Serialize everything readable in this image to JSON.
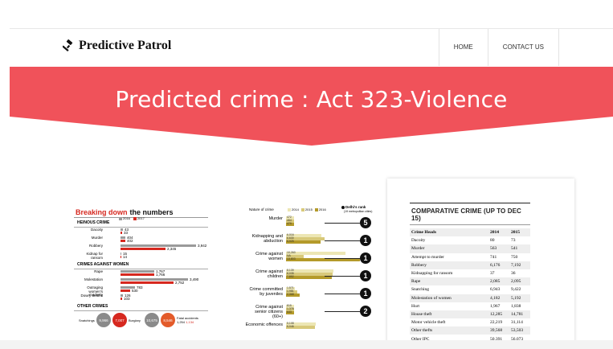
{
  "brand": {
    "name": "Predictive Patrol",
    "icon": "gavel-icon"
  },
  "nav": {
    "items": [
      {
        "label": "HOME"
      },
      {
        "label": "CONTACT US"
      }
    ]
  },
  "banner": {
    "title": "Predicted crime : Act 323-Violence",
    "color": "#f0525a"
  },
  "card1": {
    "title_red": "Breaking down",
    "title_black": "the numbers",
    "legend": [
      "2016",
      "2017"
    ],
    "legend_colors": [
      "#9a9a9a",
      "#d6281f"
    ],
    "sections": [
      {
        "name": "HEINOUS CRIME",
        "rows": [
          {
            "label": "Dacoity",
            "v1": "43",
            "v2": "33",
            "w1": 3,
            "w2": 2
          },
          {
            "label": "Murder",
            "v1": "404",
            "v2": "402",
            "w1": 6,
            "w2": 6
          },
          {
            "label": "Robbery",
            "v1": "3,942",
            "v2": "2,345",
            "w1": 94,
            "w2": 56
          },
          {
            "label": "Kidnap for ransom",
            "v1": "15",
            "v2": "14",
            "w1": 1,
            "w2": 1
          }
        ]
      },
      {
        "name": "CRIMES AGAINST WOMEN",
        "rows": [
          {
            "label": "Rape",
            "v1": "1,767",
            "v2": "1,766",
            "w1": 42,
            "w2": 42
          },
          {
            "label": "Molestation",
            "v1": "3,490",
            "v2": "2,752",
            "w1": 84,
            "w2": 66
          },
          {
            "label": "Outraging women's modesty",
            "v1": "783",
            "v2": "530",
            "w1": 18,
            "w2": 12
          },
          {
            "label": "Dowry deaths",
            "v1": "126",
            "v2": "103",
            "w1": 3,
            "w2": 2
          }
        ]
      }
    ],
    "other": {
      "name": "OTHER CRIMES",
      "circles": [
        {
          "label": "Snatchings",
          "v": "9,966",
          "color": "#8a8a8a"
        },
        {
          "label": "",
          "v": "7,007",
          "color": "#d6281f"
        },
        {
          "label": "Burglary",
          "v": "10,675",
          "color": "#8a8a8a"
        },
        {
          "label": "",
          "v": "8,546",
          "color": "#e35b2a"
        }
      ],
      "fatal": {
        "label": "Fatal accidents",
        "v1": "1,254",
        "v2": "1,134"
      }
    }
  },
  "card2": {
    "col_title": "Nature of crime",
    "legend": [
      "2014",
      "2015",
      "2016"
    ],
    "legend_colors": [
      "#ece6b4",
      "#d8c97a",
      "#b49a2a"
    ],
    "rank_title": "Delhi's rank",
    "rank_sub": "(19 metropolitan cities)",
    "rows": [
      {
        "label": "Murder",
        "bars": [
          "472",
          "464",
          "479"
        ],
        "widths": [
          6,
          6,
          6
        ],
        "rank": "5"
      },
      {
        "label": "Kidnapping and abduction",
        "bars": [
          "6,016",
          "6,630",
          "5,925"
        ],
        "widths": [
          44,
          48,
          43
        ],
        "rank": "1"
      },
      {
        "label": "Crime against women",
        "bars": [
          "10,260",
          "NA",
          "13,803"
        ],
        "widths": [
          74,
          22,
          92
        ],
        "rank": "1"
      },
      {
        "label": "Crime against children",
        "bars": [
          "8,139",
          "8,035",
          "7,852"
        ],
        "widths": [
          59,
          58,
          57
        ],
        "rank": "1"
      },
      {
        "label": "Crime committed by juveniles",
        "bars": [
          "1,571",
          "1,981",
          "2,368"
        ],
        "widths": [
          11,
          14,
          17
        ],
        "rank": "1"
      },
      {
        "label": "Crime against senior citizens (60+)",
        "bars": [
          "815",
          "1,376",
          "643"
        ],
        "widths": [
          6,
          10,
          5
        ],
        "rank": "2"
      },
      {
        "label": "Economic offences",
        "bars": [
          "5,108",
          "5,046",
          ""
        ],
        "widths": [
          37,
          36,
          0
        ],
        "rank": ""
      }
    ]
  },
  "card3": {
    "title": "COMPARATIVE CRIME (UP TO DEC 15)",
    "header": [
      "Crime Heads",
      "2014",
      "2015"
    ],
    "rows": [
      [
        "Dacoity",
        "80",
        "73"
      ],
      [
        "Murder",
        "563",
        "541"
      ],
      [
        "Attempt to murder",
        "741",
        "750"
      ],
      [
        "Robbery",
        "6,176",
        "7,192"
      ],
      [
        "Kidnapping for ransom",
        "37",
        "36"
      ],
      [
        "Rape",
        "2,085",
        "2,095"
      ],
      [
        "Snatching",
        "6,943",
        "9,422"
      ],
      [
        "Molestation of women",
        "4,182",
        "5,192"
      ],
      [
        "Hurt",
        "1,967",
        "1,838"
      ],
      [
        "House theft",
        "12,285",
        "14,781"
      ],
      [
        "Motor vehicle theft",
        "22,219",
        "31,114"
      ],
      [
        "Other thefts",
        "39,568",
        "53,503"
      ],
      [
        "Other IPC",
        "50,391",
        "56,073"
      ]
    ]
  }
}
